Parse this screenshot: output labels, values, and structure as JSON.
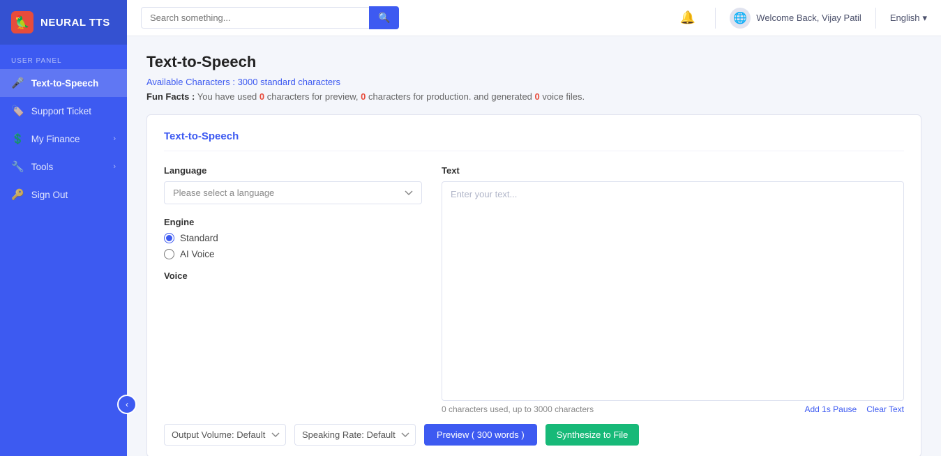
{
  "app": {
    "name": "NEURAL TTS",
    "logo_emoji": "🦜"
  },
  "sidebar": {
    "section_label": "USER PANEL",
    "items": [
      {
        "id": "tts",
        "label": "Text-to-Speech",
        "icon": "🎤",
        "active": true,
        "has_chevron": false
      },
      {
        "id": "support",
        "label": "Support Ticket",
        "icon": "🏷️",
        "active": false,
        "has_chevron": false
      },
      {
        "id": "finance",
        "label": "My Finance",
        "icon": "💲",
        "active": false,
        "has_chevron": true
      },
      {
        "id": "tools",
        "label": "Tools",
        "icon": "🔧",
        "active": false,
        "has_chevron": true
      },
      {
        "id": "signout",
        "label": "Sign Out",
        "icon": "🔑",
        "active": false,
        "has_chevron": false
      }
    ]
  },
  "topbar": {
    "search_placeholder": "Search something...",
    "welcome_text": "Welcome Back, Vijay Patil",
    "language": "English",
    "language_dropdown_arrow": "▾"
  },
  "page": {
    "title": "Text-to-Speech",
    "available_chars_label": "Available Characters :",
    "available_chars_value": "3000 standard characters",
    "fun_facts_label": "Fun Facts :",
    "fun_facts_text": "You have used",
    "fun_facts_preview_count": "0",
    "fun_facts_preview_label": "characters for preview,",
    "fun_facts_production_count": "0",
    "fun_facts_production_label": "characters for production.",
    "fun_facts_voice_label": "and generated",
    "fun_facts_voice_count": "0",
    "fun_facts_voice_suffix": "voice files."
  },
  "tts_card": {
    "title": "Text-to-Speech",
    "language_label": "Language",
    "language_placeholder": "Please select a language",
    "engine_label": "Engine",
    "engine_options": [
      {
        "id": "standard",
        "label": "Standard",
        "checked": true
      },
      {
        "id": "ai_voice",
        "label": "AI Voice",
        "checked": false
      }
    ],
    "voice_label": "Voice",
    "text_label": "Text",
    "text_placeholder": "Enter your text...",
    "char_count_text": "0 characters used, up to 3000 characters",
    "add_pause_label": "Add 1s Pause",
    "clear_text_label": "Clear Text",
    "output_volume_placeholder": "Output Volume: Default",
    "speaking_rate_placeholder": "Speaking Rate: Default",
    "preview_button": "Preview ( 300 words )",
    "synthesize_button": "Synthesize to File"
  }
}
